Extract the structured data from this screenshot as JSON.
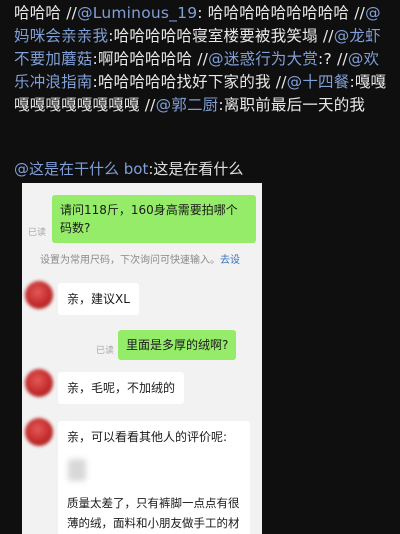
{
  "post": {
    "segments": [
      {
        "t": "哈哈哈 //",
        "m": false
      },
      {
        "t": "@Luminous_19",
        "m": true
      },
      {
        "t": ": 哈哈哈哈哈哈哈哈哈 //",
        "m": false
      },
      {
        "t": "@妈咪会亲亲我",
        "m": true
      },
      {
        "t": ":哈哈哈哈哈寝室楼要被我笑塌 //",
        "m": false
      },
      {
        "t": "@龙虾不要加蘑菇",
        "m": true
      },
      {
        "t": ":啊哈哈哈哈哈 //",
        "m": false
      },
      {
        "t": "@迷惑行为大赏",
        "m": true
      },
      {
        "t": ":? //",
        "m": false
      },
      {
        "t": "@欢乐冲浪指南",
        "m": true
      },
      {
        "t": ":哈哈哈哈哈找好下家的我 //",
        "m": false
      },
      {
        "t": "@十四餐",
        "m": true
      },
      {
        "t": ":嘎嘎嘎嘎嘎嘎嘎嘎嘎嘎 //",
        "m": false
      },
      {
        "t": "@郭二厨",
        "m": true
      },
      {
        "t": ":离职前最后一天的我",
        "m": false
      }
    ]
  },
  "comment": {
    "mention": "@这是在干什么 bot",
    "text": ":这是在看什么"
  },
  "chat": {
    "msg1": "请问118斤，160身高需要拍哪个码数?",
    "msg1_line1": "请问118斤，160身高需要拍哪个",
    "msg1_line2": "码数?",
    "read1": "已读",
    "tip_text": "设置为常用尺码，下次询问可快速输入。",
    "tip_link": "去设",
    "reply1": "亲，建议XL",
    "msg2": "里面是多厚的绒啊?",
    "read2": "已读",
    "reply2": "亲，毛呢，不加绒的",
    "reply3_line1": "亲，可以看看其他人的评价呢:",
    "review_line1": "质量太差了，只有裤脚一点点有很",
    "review_line2": "薄的绒，面料和小朋友做手工的材"
  },
  "colors": {
    "background": "#0f0f0f",
    "mention": "#7f9fd6",
    "green_bubble": "#95ec69",
    "chat_bg": "#f2f2f2"
  }
}
